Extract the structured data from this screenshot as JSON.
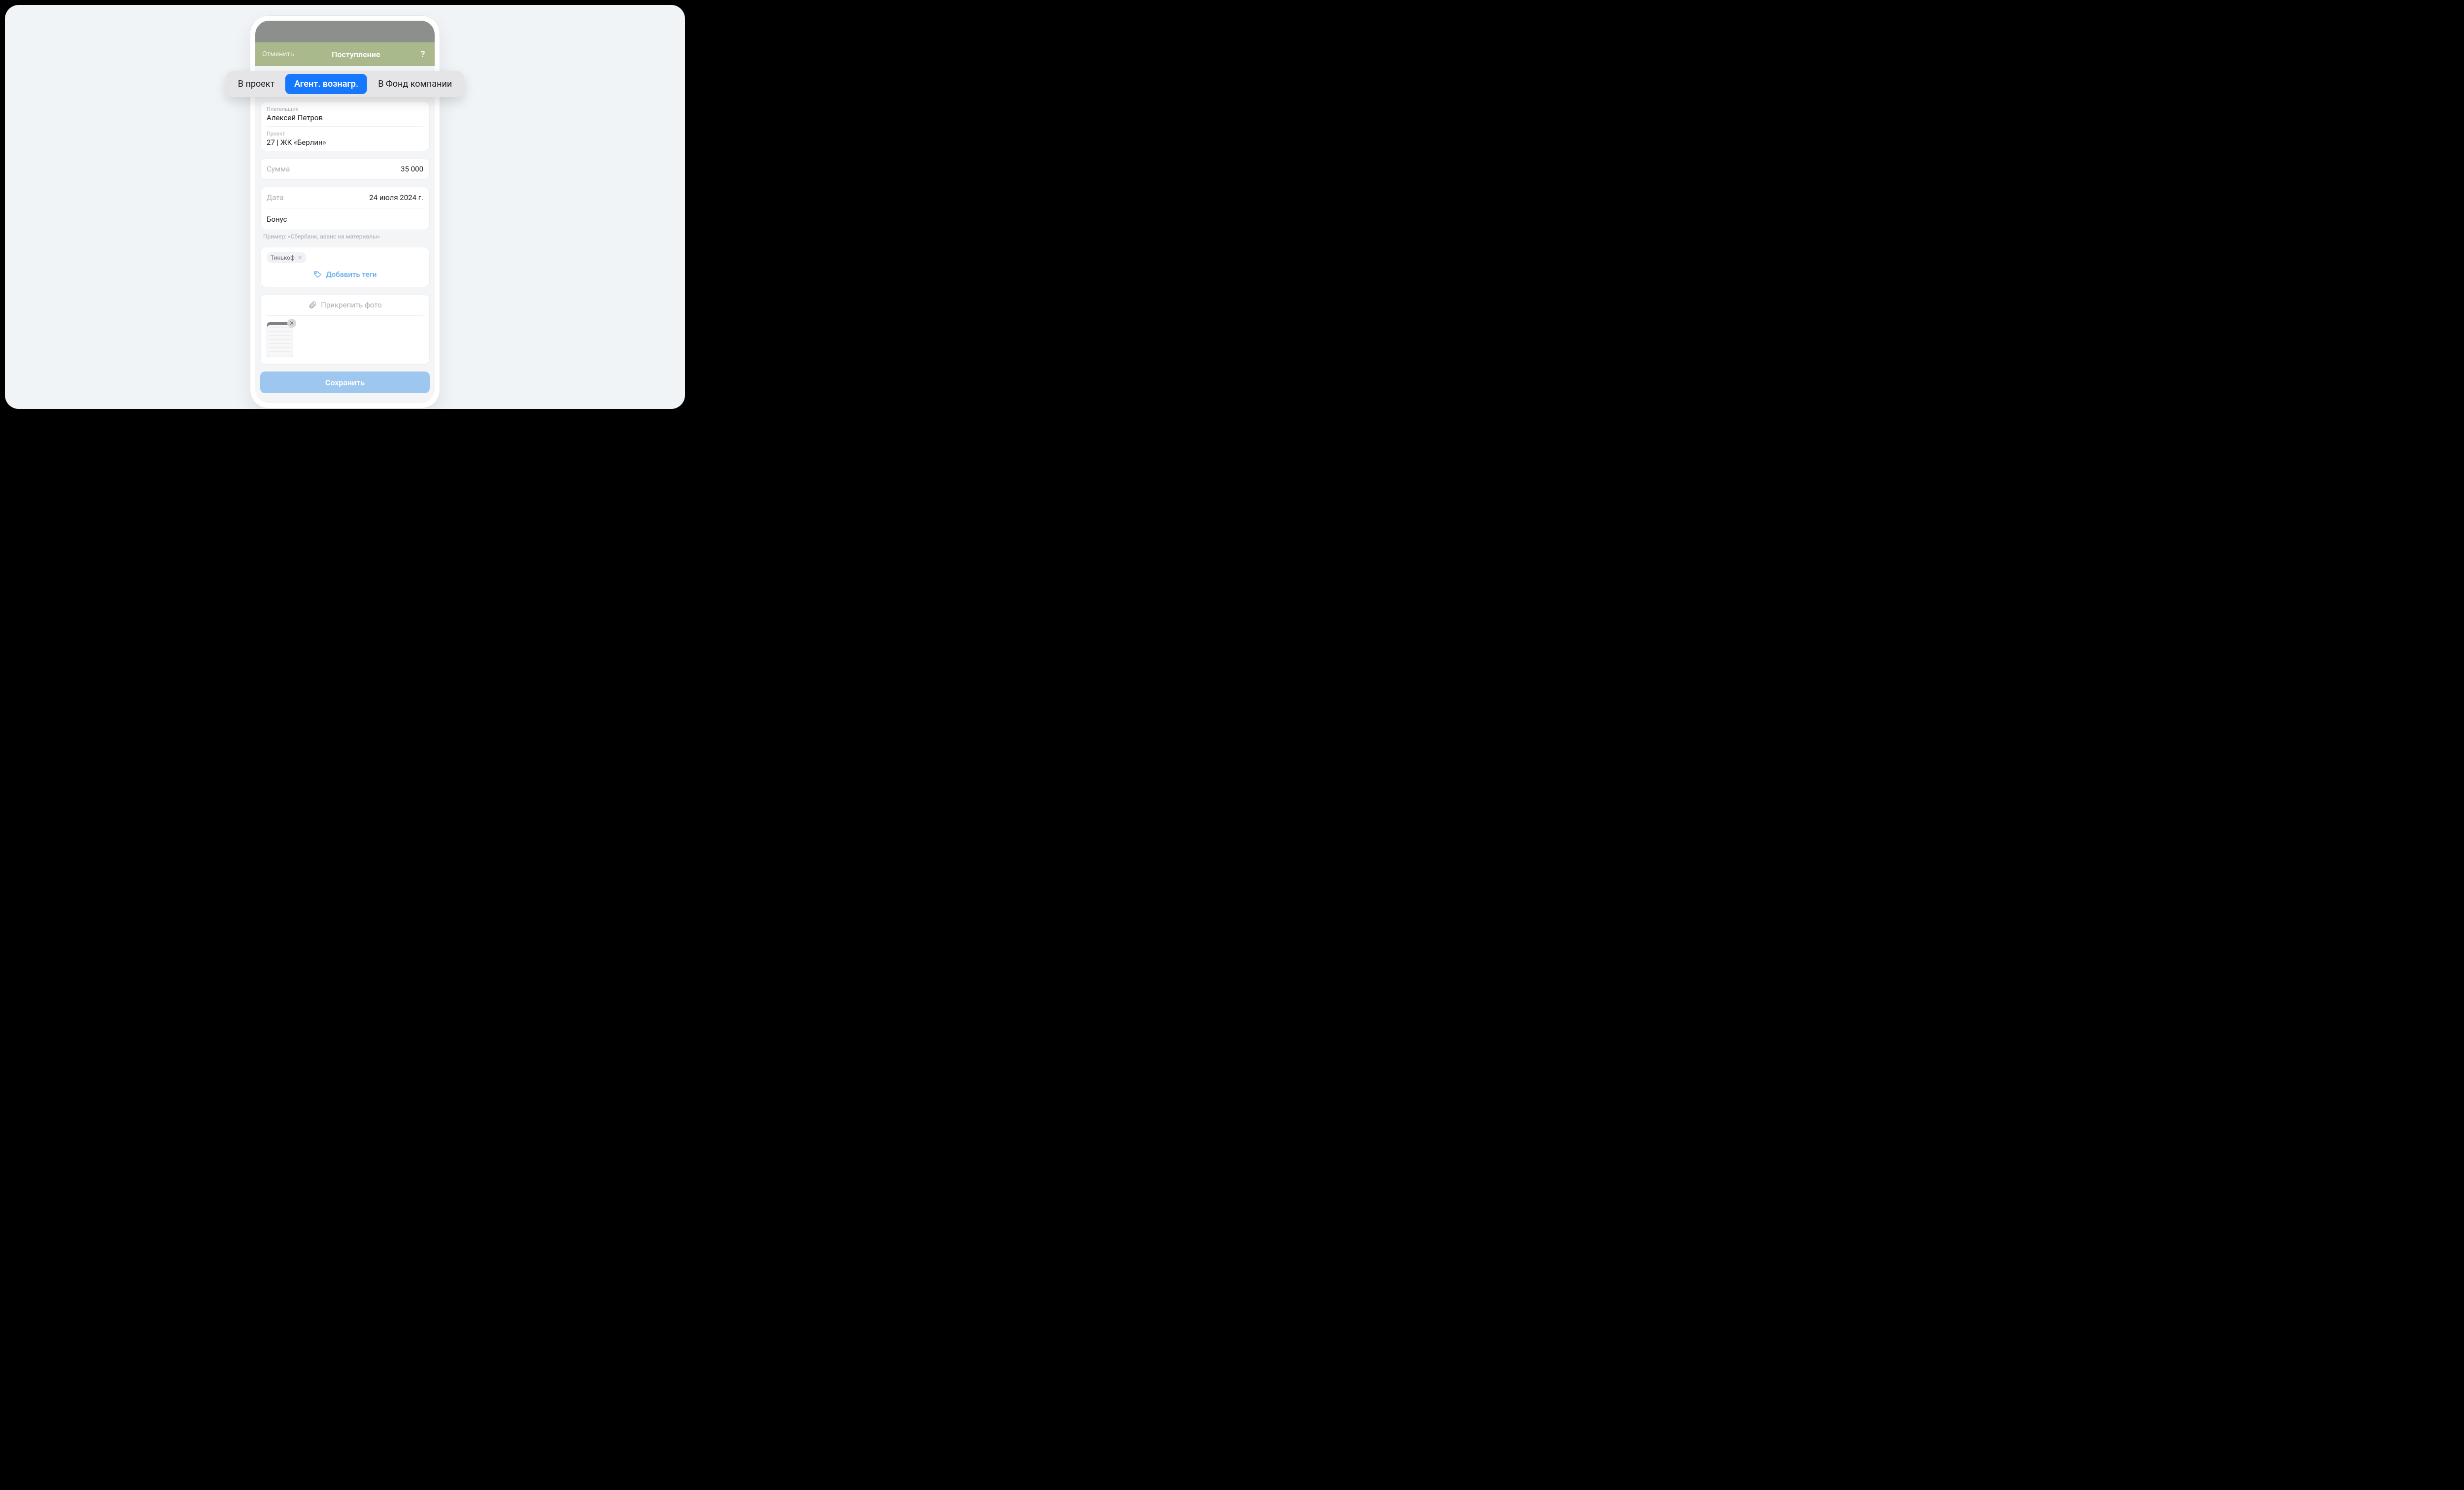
{
  "nav": {
    "cancel": "Отменить",
    "title": "Поступление",
    "help": "?"
  },
  "tabs": {
    "project": "В проект",
    "agent": "Агент. вознагр.",
    "fund": "В Фонд компании"
  },
  "payer": {
    "label": "Плательщик",
    "value": "Алексей Петров"
  },
  "project": {
    "label": "Проект",
    "value": "27 | ЖК «Берлин»"
  },
  "amount": {
    "label": "Сумма",
    "value": "35 000"
  },
  "date": {
    "label": "Дата",
    "value": "24 июля 2024 г."
  },
  "note": {
    "value": "Бонус",
    "hint": "Пример: «Сбербанк, аванс на материалы»"
  },
  "tags": {
    "chip": "Тинькоф",
    "chip_x": "✕",
    "add": "Добавить теги"
  },
  "attach": {
    "label": "Прикрепить фото",
    "thumb_x": "✕"
  },
  "save": "Сохранить"
}
